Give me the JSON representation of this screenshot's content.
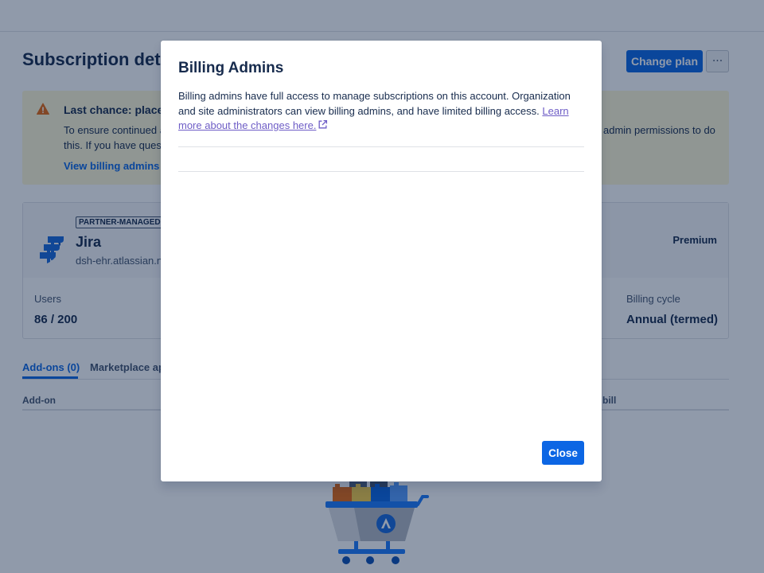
{
  "page": {
    "title": "Subscription details",
    "change_plan_label": "Change plan",
    "more_label": "···"
  },
  "banner": {
    "title": "Last chance: place",
    "text_line1_start": "To ensure continued a",
    "text_line1_end": "admin permissions to do",
    "text_line2": "this. If you have quest",
    "link": "View billing admins"
  },
  "product": {
    "badge": "PARTNER-MANAGED",
    "name": "Jira",
    "url": "dsh-ehr.atlassian.n",
    "plan": "Premium",
    "users_label": "Users",
    "users_value": "86 / 200",
    "billing_cycle_label": "Billing cycle",
    "billing_cycle_value": "Annual (termed)"
  },
  "tabs": {
    "addons": "Add-ons (0)",
    "marketplace": "Marketplace ap"
  },
  "table": {
    "col_addon": "Add-on",
    "col_bill": "bill"
  },
  "modal": {
    "title": "Billing Admins",
    "description": "Billing admins have full access to manage subscriptions on this account. Organization and site administrators can view billing admins, and have limited billing access. ",
    "link": "Learn more about the changes here.",
    "close_label": "Close"
  },
  "colors": {
    "primary": "#0c66e4",
    "banner_bg": "#fff7d6",
    "warning": "#e56910",
    "visited_link": "#6e5dc6"
  },
  "icons": [
    "warning-icon",
    "jira-logo-icon",
    "more-icon",
    "external-link-icon",
    "shopping-cart-illustration"
  ]
}
